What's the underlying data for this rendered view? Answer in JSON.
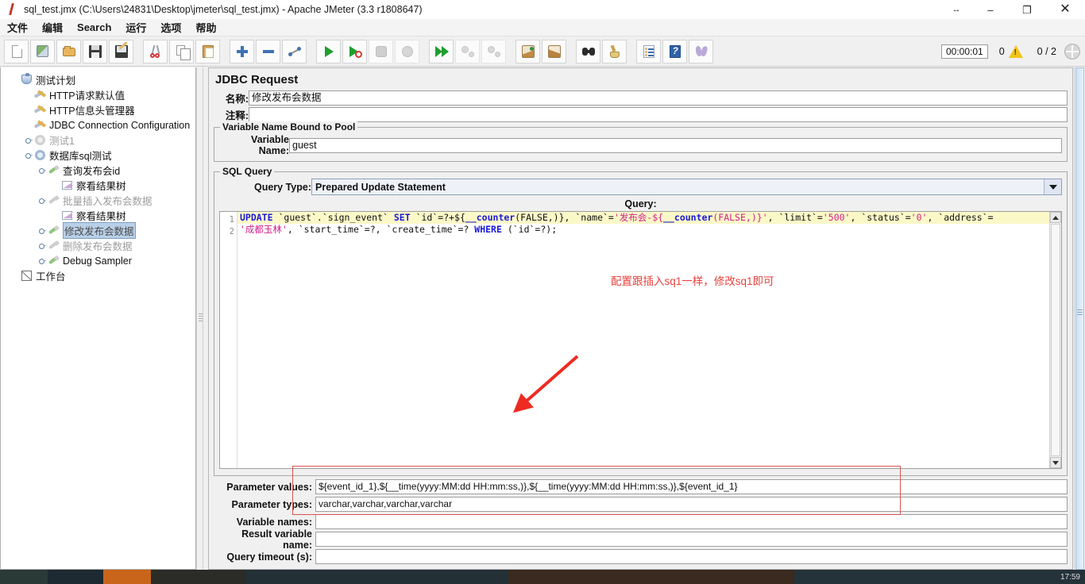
{
  "window": {
    "title": "sql_test.jmx (C:\\Users\\24831\\Desktop\\jmeter\\sql_test.jmx) - Apache JMeter (3.3 r1808647)",
    "minimize": "–",
    "maximize": "❐",
    "close": "✕",
    "restore_arrows": "↔"
  },
  "menu": [
    "文件",
    "编辑",
    "Search",
    "运行",
    "选项",
    "帮助"
  ],
  "toolbar": {
    "buttons": [
      {
        "name": "new-icon",
        "label": "New"
      },
      {
        "name": "templates-icon",
        "label": "Templates"
      },
      {
        "name": "open-icon",
        "label": "Open"
      },
      {
        "name": "save-icon",
        "label": "Save"
      },
      {
        "name": "save-as-icon",
        "label": "Save As"
      },
      {
        "name": "cut-icon",
        "label": "Cut"
      },
      {
        "name": "copy-icon",
        "label": "Copy"
      },
      {
        "name": "paste-icon",
        "label": "Paste"
      },
      {
        "name": "expand-all-icon",
        "label": "Expand All"
      },
      {
        "name": "collapse-all-icon",
        "label": "Collapse All"
      },
      {
        "name": "toggle-icon",
        "label": "Toggle"
      },
      {
        "name": "start-icon",
        "label": "Start"
      },
      {
        "name": "start-no-pauses-icon",
        "label": "Start no pauses"
      },
      {
        "name": "stop-icon",
        "label": "Stop"
      },
      {
        "name": "shutdown-icon",
        "label": "Shutdown"
      },
      {
        "name": "start-remote-all-icon",
        "label": "Start remote all"
      },
      {
        "name": "stop-remote-all-icon",
        "label": "Stop remote all"
      },
      {
        "name": "shutdown-remote-all-icon",
        "label": "Shutdown remote all"
      },
      {
        "name": "clear-icon",
        "label": "Clear"
      },
      {
        "name": "clear-all-icon",
        "label": "Clear All"
      },
      {
        "name": "search-icon",
        "label": "Search"
      },
      {
        "name": "reset-search-icon",
        "label": "Reset Search"
      },
      {
        "name": "function-helper-icon",
        "label": "Function Helper Dialog"
      },
      {
        "name": "help-icon",
        "label": "Help"
      },
      {
        "name": "undo-icon",
        "label": "Undo"
      }
    ],
    "timer": "00:00:01",
    "error_count": "0",
    "threads": "0 / 2"
  },
  "tree": {
    "nodes": [
      {
        "label": "测试计划",
        "icon": "test-plan-icon",
        "depth": 0,
        "state": "normal",
        "expander": false
      },
      {
        "label": "HTTP请求默认值",
        "icon": "config-element-icon",
        "depth": 1,
        "state": "normal",
        "expander": false
      },
      {
        "label": "HTTP信息头管理器",
        "icon": "config-element-icon",
        "depth": 1,
        "state": "normal",
        "expander": false
      },
      {
        "label": "JDBC Connection Configuration",
        "icon": "config-element-icon",
        "depth": 1,
        "state": "normal",
        "expander": false
      },
      {
        "label": "测试1",
        "icon": "thread-group-icon",
        "depth": 1,
        "state": "disabled",
        "expander": true
      },
      {
        "label": "数据库sql测试",
        "icon": "thread-group-icon",
        "depth": 1,
        "state": "normal",
        "expander": true
      },
      {
        "label": "查询发布会id",
        "icon": "sampler-icon",
        "depth": 2,
        "state": "normal",
        "expander": true
      },
      {
        "label": "察看结果树",
        "icon": "view-results-tree-icon",
        "depth": 3,
        "state": "normal",
        "expander": false
      },
      {
        "label": "批量插入发布会数据",
        "icon": "sampler-icon",
        "depth": 2,
        "state": "disabled",
        "expander": true
      },
      {
        "label": "察看结果树",
        "icon": "view-results-tree-icon",
        "depth": 3,
        "state": "normal",
        "expander": false
      },
      {
        "label": "修改发布会数据",
        "icon": "sampler-icon",
        "depth": 2,
        "state": "selected",
        "expander": true
      },
      {
        "label": "删除发布会数据",
        "icon": "sampler-icon",
        "depth": 2,
        "state": "disabled",
        "expander": true
      },
      {
        "label": "Debug Sampler",
        "icon": "sampler-icon",
        "depth": 2,
        "state": "normal",
        "expander": true
      },
      {
        "label": "工作台",
        "icon": "workbench-icon",
        "depth": 0,
        "state": "normal",
        "expander": false
      }
    ]
  },
  "panel": {
    "title": "JDBC Request",
    "name_label": "名称:",
    "name_value": "修改发布会数据",
    "comment_label": "注释:",
    "comment_value": "",
    "pool_group_title": "Variable Name Bound to Pool",
    "variable_name_label": "Variable Name:",
    "variable_name_value": "guest",
    "sql_group_title": "SQL Query",
    "query_type_label": "Query Type:",
    "query_type_value": "Prepared Update Statement",
    "query_label": "Query:",
    "editor": {
      "line_numbers": [
        "1",
        "2"
      ],
      "sql_line1_tokens": [
        {
          "t": "UPDATE",
          "c": "k"
        },
        {
          "t": " `guest`.`sign_event` ",
          "c": "id"
        },
        {
          "t": "SET",
          "c": "k"
        },
        {
          "t": " `id`=?+${",
          "c": "id"
        },
        {
          "t": "__counter",
          "c": "fn"
        },
        {
          "t": "(FALSE,)}, `name`=",
          "c": "id"
        },
        {
          "t": "'发布会-${",
          "c": "str"
        },
        {
          "t": "__counter",
          "c": "fn"
        },
        {
          "t": "(FALSE,)}'",
          "c": "str"
        },
        {
          "t": ", `limit`=",
          "c": "id"
        },
        {
          "t": "'500'",
          "c": "str"
        },
        {
          "t": ", `status`=",
          "c": "id"
        },
        {
          "t": "'0'",
          "c": "str"
        },
        {
          "t": ", `address`=",
          "c": "id"
        }
      ],
      "sql_line1_plain": "UPDATE `guest`.`sign_event` SET `id`=?+${__counter(FALSE,)}, `name`='发布会-${__counter(FALSE,)}', `limit`='500', `status`='0', `address`=",
      "sql_line2_tokens": [
        {
          "t": "'成都玉林'",
          "c": "str"
        },
        {
          "t": ", `start_time`=?, `create_time`=? ",
          "c": "id"
        },
        {
          "t": "WHERE",
          "c": "k"
        },
        {
          "t": " (`id`=?);",
          "c": "id"
        }
      ],
      "sql_line2_plain": "'成都玉林', `start_time`=?, `create_time`=? WHERE (`id`=?);",
      "annotation": "配置跟插入sq1一样，修改sq1即可",
      "annotation_color": "#e8413c",
      "arrow_color": "#ee2b22"
    },
    "fields": [
      {
        "label": "Parameter values:",
        "value": "${event_id_1},${__time(yyyy:MM:dd HH:mm:ss,)},${__time(yyyy:MM:dd HH:mm:ss,)},${event_id_1}",
        "name": "parameter-values-input"
      },
      {
        "label": "Parameter types:",
        "value": "varchar,varchar,varchar,varchar",
        "name": "parameter-types-input"
      },
      {
        "label": "Variable names:",
        "value": "",
        "name": "variable-names-input"
      },
      {
        "label": "Result variable name:",
        "value": "",
        "name": "result-variable-name-input"
      },
      {
        "label": "Query timeout (s):",
        "value": "",
        "name": "query-timeout-input"
      }
    ]
  },
  "taskbar": {
    "clock": "17:59"
  }
}
